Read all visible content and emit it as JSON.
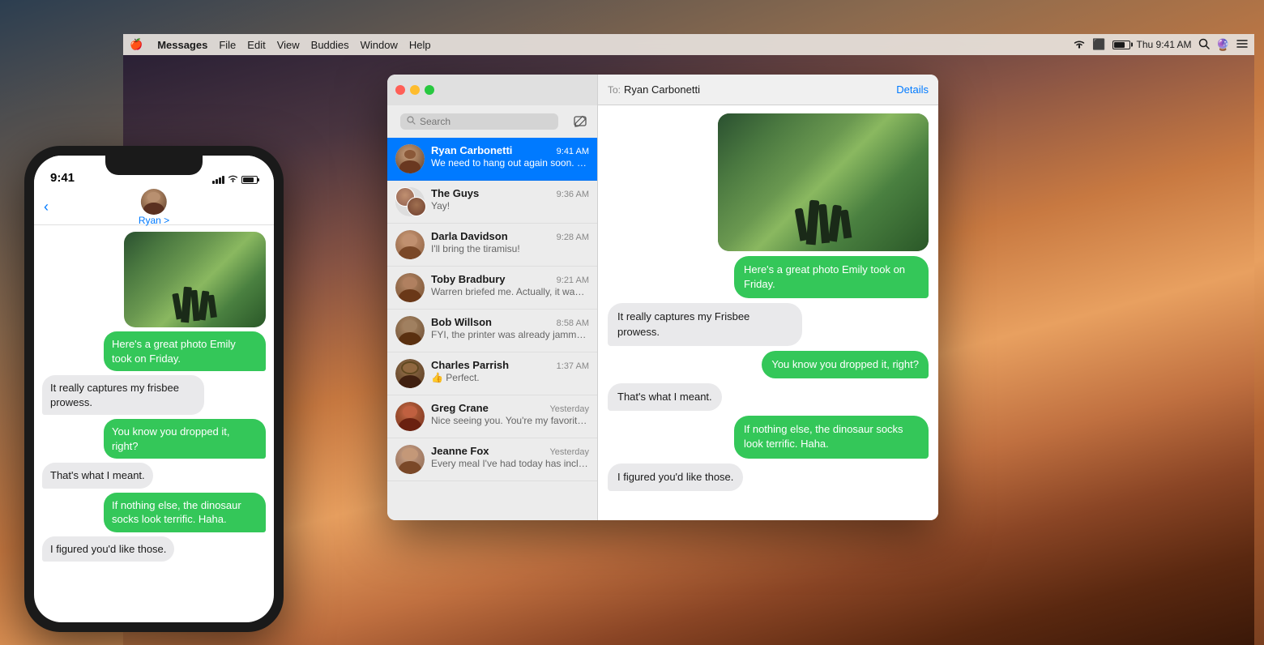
{
  "app": {
    "title": "Messages",
    "menu": {
      "apple": "🍎",
      "app_name": "Messages",
      "items": [
        "File",
        "Edit",
        "View",
        "Buddies",
        "Window",
        "Help"
      ]
    },
    "menubar_right": {
      "time": "Thu 9:41 AM"
    }
  },
  "messages_window": {
    "search_placeholder": "Search",
    "to_label": "To:",
    "to_name": "Ryan Carbonetti",
    "details_label": "Details",
    "conversations": [
      {
        "id": "ryan",
        "name": "Ryan Carbonetti",
        "time": "9:41 AM",
        "preview": "We need to hang out again soon. Don't be extinct, okay?",
        "active": true
      },
      {
        "id": "guys",
        "name": "The Guys",
        "time": "9:36 AM",
        "preview": "Yay!",
        "active": false
      },
      {
        "id": "darla",
        "name": "Darla Davidson",
        "time": "9:28 AM",
        "preview": "I'll bring the tiramisu!",
        "active": false
      },
      {
        "id": "toby",
        "name": "Toby Bradbury",
        "time": "9:21 AM",
        "preview": "Warren briefed me. Actually, it wasn't that brief.💤",
        "active": false
      },
      {
        "id": "bob",
        "name": "Bob Willson",
        "time": "8:58 AM",
        "preview": "FYI, the printer was already jammed when I got there.",
        "active": false
      },
      {
        "id": "charles",
        "name": "Charles Parrish",
        "time": "1:37 AM",
        "preview": "👍 Perfect.",
        "active": false
      },
      {
        "id": "greg",
        "name": "Greg Crane",
        "time": "Yesterday",
        "preview": "Nice seeing you. You're my favorite person to randomly...",
        "active": false
      },
      {
        "id": "jeanne",
        "name": "Jeanne Fox",
        "time": "Yesterday",
        "preview": "Every meal I've had today has included bacon. #winning",
        "active": false
      }
    ],
    "chat_messages": [
      {
        "type": "photo",
        "direction": "out"
      },
      {
        "type": "text",
        "direction": "out",
        "text": "Here's a great photo Emily took on Friday."
      },
      {
        "type": "text",
        "direction": "in",
        "text": "It really captures my Frisbee prowess."
      },
      {
        "type": "text",
        "direction": "out",
        "text": "You know you dropped it, right?"
      },
      {
        "type": "text",
        "direction": "in",
        "text": "That's what I meant."
      },
      {
        "type": "text",
        "direction": "out",
        "text": "If nothing else, the dinosaur socks look terrific. Haha."
      },
      {
        "type": "text",
        "direction": "in",
        "text": "I figured you'd like those."
      }
    ]
  },
  "iphone": {
    "time": "9:41",
    "contact_name": "Ryan",
    "contact_sub": "Ryan >",
    "messages": [
      {
        "type": "photo",
        "direction": "out"
      },
      {
        "type": "text",
        "direction": "out",
        "text": "Here's a great photo Emily took on Friday."
      },
      {
        "type": "text",
        "direction": "in",
        "text": "It really captures my frisbee prowess."
      },
      {
        "type": "text",
        "direction": "out",
        "text": "You know you dropped it, right?"
      },
      {
        "type": "text",
        "direction": "in",
        "text": "That's what I meant."
      },
      {
        "type": "text",
        "direction": "out",
        "text": "If nothing else, the dinosaur socks look terrific. Haha."
      },
      {
        "type": "text",
        "direction": "in",
        "text": "I figured you'd like those."
      }
    ]
  },
  "colors": {
    "accent": "#007aff",
    "green_bubble": "#34c759",
    "gray_bubble": "#e9e9eb",
    "active_conv": "#007aff",
    "close": "#ff5f57",
    "minimize": "#febc2e",
    "maximize": "#28c840"
  }
}
